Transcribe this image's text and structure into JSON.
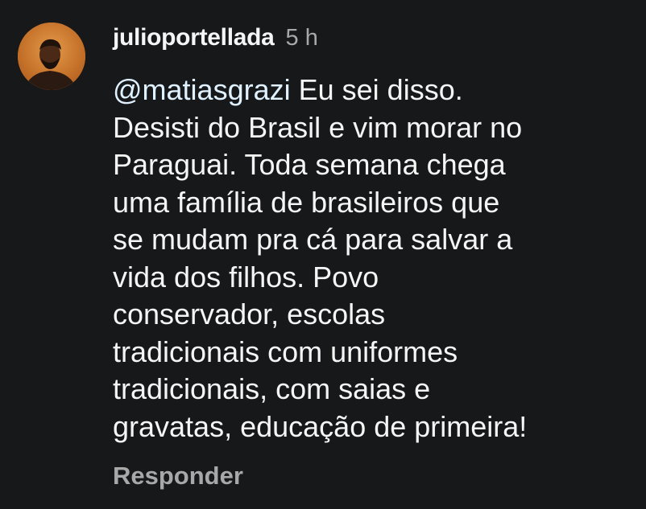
{
  "comment": {
    "username": "julioportellada",
    "timestamp": "5 h",
    "avatar_icon": "user-avatar",
    "mention": "@matiasgrazi",
    "lines": [
      " Eu sei disso.",
      "Desisti do Brasil e vim morar no",
      "Paraguai. Toda semana chega",
      "uma família de brasileiros que",
      "se mudam pra cá para salvar a",
      "vida dos filhos. Povo",
      "conservador, escolas",
      "tradicionais com uniformes",
      "tradicionais, com saias e",
      "gravatas, educação de primeira!"
    ],
    "reply_label": "Responder"
  },
  "colors": {
    "background": "#17181a",
    "text": "#f5f5f5",
    "muted": "#a8a8a8",
    "mention": "#e0f1ff",
    "avatar_bg": "#c8742a"
  }
}
